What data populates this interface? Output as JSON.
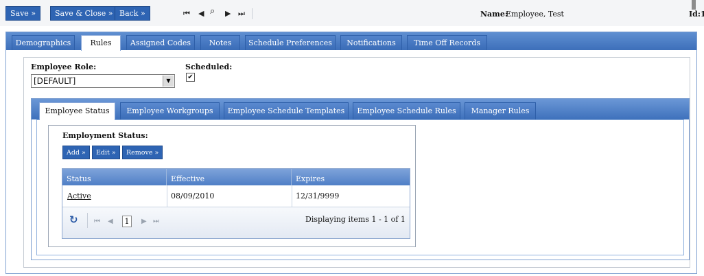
{
  "toolbar": {
    "save_label": "Save »",
    "save_close_label": "Save & Close »",
    "back_label": "Back »",
    "nav_first": "⏮",
    "nav_prev": "◀",
    "nav_search": "⌕",
    "nav_next": "▶",
    "nav_last": "⏭",
    "name_label": "Name:",
    "name_value": "Employee, Test",
    "id_label": "Id:1"
  },
  "outer_tabs": [
    {
      "label": "Demographics"
    },
    {
      "label": "Rules"
    },
    {
      "label": "Assigned Codes"
    },
    {
      "label": "Notes"
    },
    {
      "label": "Schedule Preferences"
    },
    {
      "label": "Notifications"
    },
    {
      "label": "Time Off Records"
    }
  ],
  "active_outer_tab": "Rules",
  "form": {
    "employee_role_label": "Employee Role:",
    "employee_role_value": "[DEFAULT]",
    "scheduled_label": "Scheduled:",
    "scheduled_checked": true,
    "check_mark": "✔"
  },
  "inner_tabs": [
    {
      "label": "Employee Status"
    },
    {
      "label": "Employee Workgroups"
    },
    {
      "label": "Employee Schedule Templates"
    },
    {
      "label": "Employee Schedule Rules"
    },
    {
      "label": "Manager Rules"
    }
  ],
  "active_inner_tab": "Employee Status",
  "employment_status": {
    "title": "Employment Status:",
    "add_label": "Add »",
    "edit_label": "Edit »",
    "remove_label": "Remove »",
    "columns": [
      "Status",
      "Effective",
      "Expires"
    ],
    "rows": [
      {
        "status": "Active",
        "effective": "08/09/2010",
        "expires": "12/31/9999"
      }
    ],
    "pager": {
      "refresh_icon": "↻",
      "first": "⏮",
      "prev": "◀",
      "page": "1",
      "next": "▶",
      "last": "⏭",
      "info": "Displaying items 1 - 1 of 1"
    }
  },
  "colors": {
    "button_blue": "#2e64b3",
    "tab_strip_blue": "#3d6fba"
  }
}
